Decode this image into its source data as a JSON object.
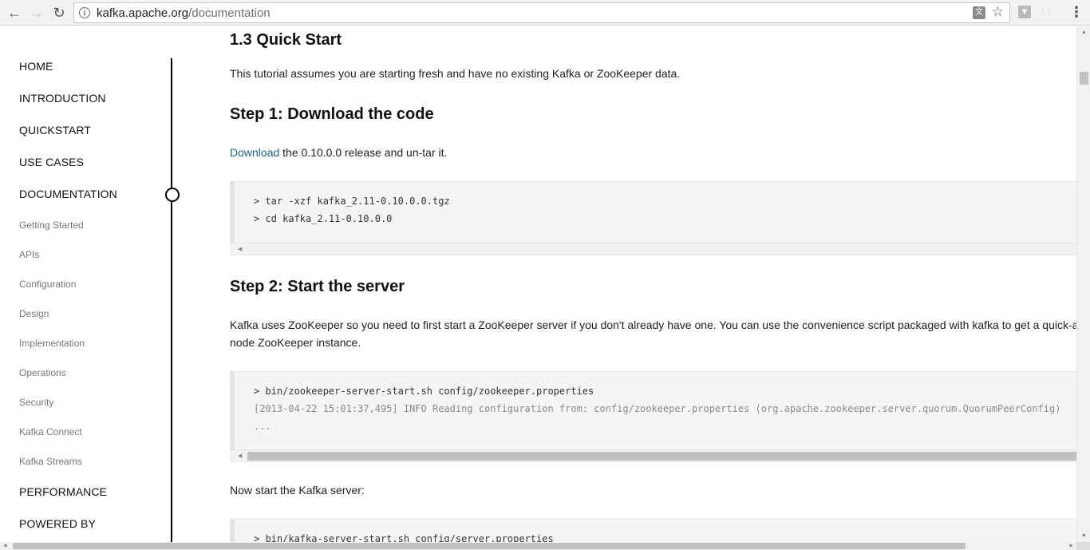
{
  "browser": {
    "url_host": "kafka.apache.org",
    "url_path": "/documentation",
    "icons": [
      "back-icon",
      "forward-icon",
      "reload-icon",
      "info-icon",
      "translate-icon",
      "star-icon",
      "extension-icon",
      "menu-icon"
    ]
  },
  "sidebar": {
    "main_items": [
      {
        "label": "HOME"
      },
      {
        "label": "INTRODUCTION"
      },
      {
        "label": "QUICKSTART"
      },
      {
        "label": "USE CASES"
      },
      {
        "label": "DOCUMENTATION"
      }
    ],
    "sub_items": [
      {
        "label": "Getting Started"
      },
      {
        "label": "APIs"
      },
      {
        "label": "Configuration"
      },
      {
        "label": "Design"
      },
      {
        "label": "Implementation"
      },
      {
        "label": "Operations"
      },
      {
        "label": "Security"
      },
      {
        "label": "Kafka Connect"
      },
      {
        "label": "Kafka Streams"
      }
    ],
    "bottom_items": [
      {
        "label": "PERFORMANCE"
      },
      {
        "label": "POWERED BY"
      }
    ]
  },
  "content": {
    "section_title": "1.3 Quick Start",
    "intro": "This tutorial assumes you are starting fresh and have no existing Kafka or ZooKeeper data.",
    "step1": {
      "title": "Step 1: Download the code",
      "link_text": "Download",
      "text_after_link": " the 0.10.0.0 release and un-tar it.",
      "code": [
        "> tar -xzf kafka_2.11-0.10.0.0.tgz",
        "> cd kafka_2.11-0.10.0.0"
      ]
    },
    "step2": {
      "title": "Step 2: Start the server",
      "text_line1": "Kafka uses ZooKeeper so you need to first start a ZooKeeper server if you don't already have one. You can use the convenience script packaged with kafka to get a quick-and-dirty single-",
      "text_line2": "node ZooKeeper instance.",
      "code": [
        "> bin/zookeeper-server-start.sh config/zookeeper.properties"
      ],
      "code_output": [
        "[2013-04-22 15:01:37,495] INFO Reading configuration from: config/zookeeper.properties (org.apache.zookeeper.server.quorum.QuorumPeerConfig)",
        "..."
      ],
      "kafka_text": "Now start the Kafka server:",
      "kafka_code": [
        "> bin/kafka-server-start.sh config/server.properties"
      ]
    }
  }
}
